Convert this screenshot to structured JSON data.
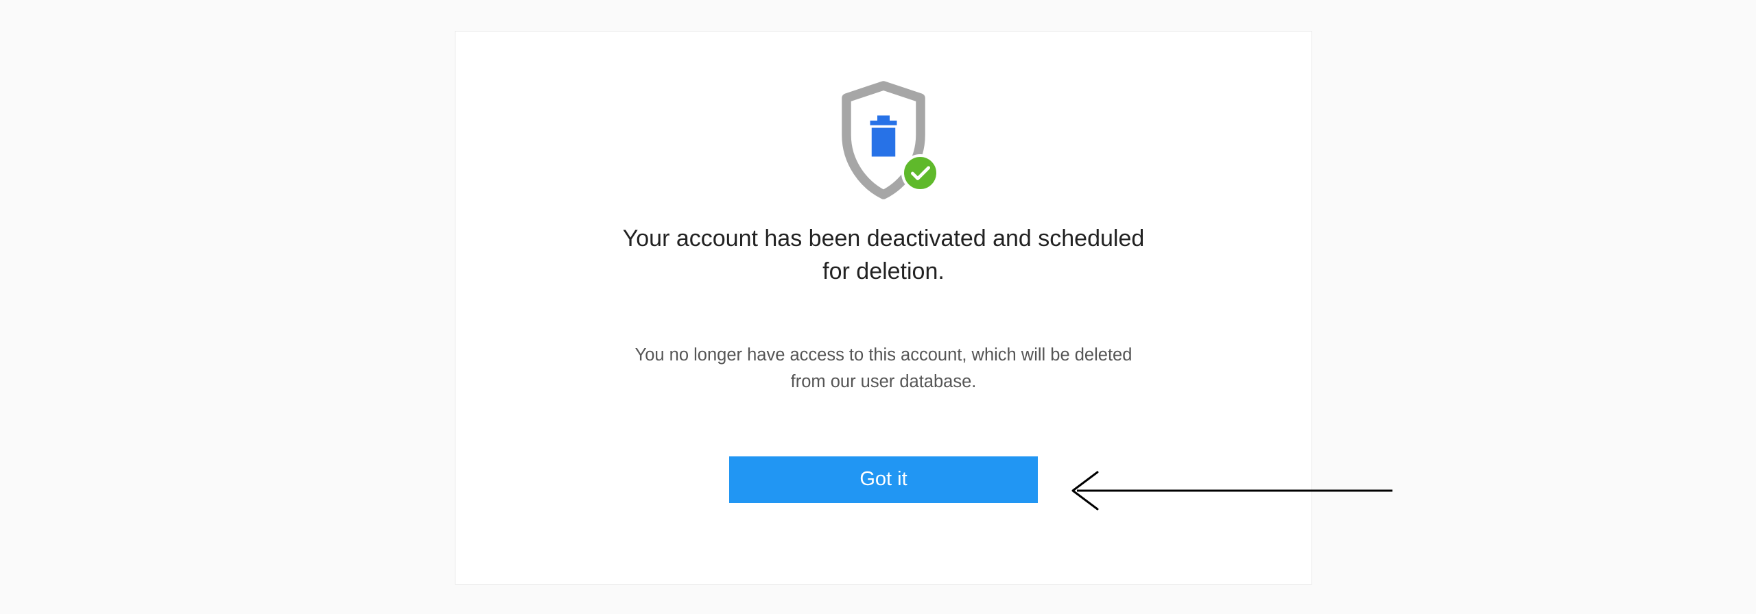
{
  "modal": {
    "heading": "Your account has been deactivated and scheduled for deletion.",
    "description": "You no longer have access to this account, which will be deleted from our user database.",
    "button_label": "Got it"
  },
  "colors": {
    "accent": "#2196f3",
    "success": "#5fb92b",
    "shield_stroke": "#a6a6a6",
    "shield_fill": "#2772e7"
  }
}
